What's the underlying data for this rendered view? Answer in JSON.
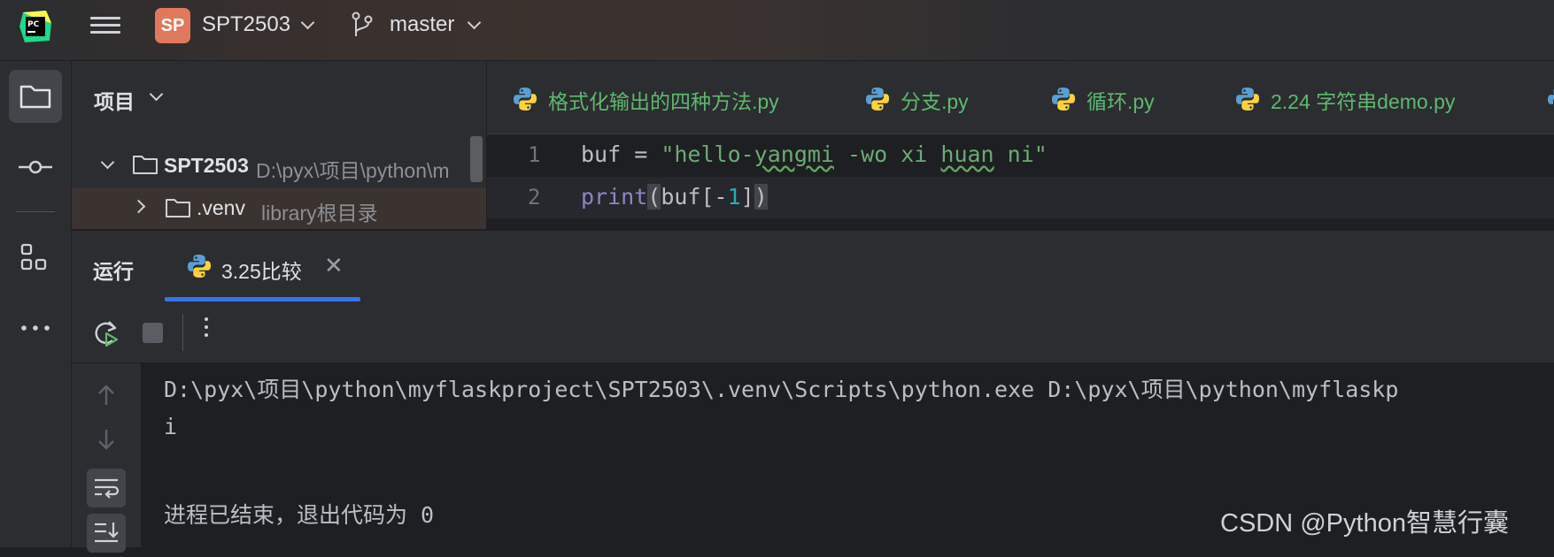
{
  "titlebar": {
    "project_badge": "SP",
    "project_name": "SPT2503",
    "branch_name": "master"
  },
  "toolstrip": {
    "icons": [
      "folder-icon",
      "commit-icon",
      "structure-icon",
      "more-icon"
    ]
  },
  "project_panel": {
    "title": "项目",
    "tree": [
      {
        "name": "SPT2503",
        "path": "D:\\pyx\\项目\\python\\m",
        "expanded": true
      },
      {
        "name": ".venv",
        "path": "library根目录",
        "expanded": false
      }
    ]
  },
  "editor": {
    "tabs": [
      "格式化输出的四种方法.py",
      "分支.py",
      "循环.py",
      "2.24 字符串demo.py"
    ],
    "line_numbers": [
      "1",
      "2"
    ],
    "line1": {
      "var": "buf",
      "op": " = ",
      "string_open": "\"hello-",
      "string_wavy1": "yangmi",
      "string_mid": " -wo xi ",
      "string_wavy2": "huan",
      "string_close": " ni\""
    },
    "line2": {
      "func": "print",
      "paren_open": "(",
      "arg": "buf[-",
      "num": "1",
      "close_bracket": "]",
      "paren_close": ")"
    }
  },
  "run_panel": {
    "title": "运行",
    "tab_label": "3.25比较",
    "close_glyph": "✕",
    "output": [
      "D:\\pyx\\项目\\python\\myflaskproject\\SPT2503\\.venv\\Scripts\\python.exe D:\\pyx\\项目\\python\\myflaskp",
      "i",
      "",
      "进程已结束，退出代码为 0"
    ]
  },
  "watermark": "CSDN @Python智慧行囊",
  "colors": {
    "accent": "#3574f0",
    "badge": "#e0785c",
    "tab_text": "#5fb86e",
    "string": "#6aab73",
    "builtin": "#8888c6",
    "number": "#2aacb8"
  }
}
